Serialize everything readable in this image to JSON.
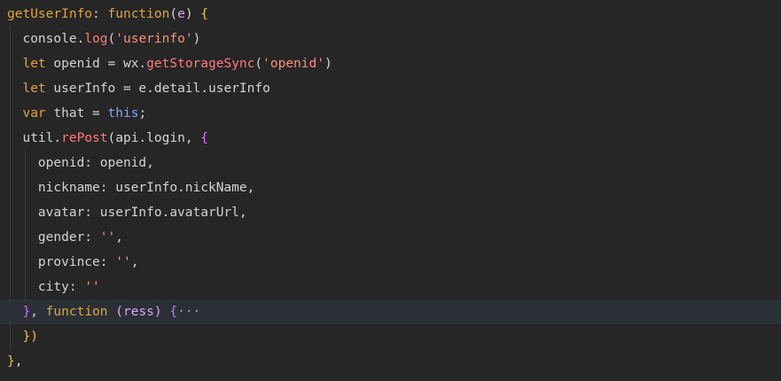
{
  "editor": {
    "background": "#262626",
    "highlight_line_background": "#2b3036",
    "lines": [
      {
        "tokens": [
          {
            "t": "getUserInfo",
            "c": "prop"
          },
          {
            "t": ": ",
            "c": "default"
          },
          {
            "t": "function",
            "c": "kw"
          },
          {
            "t": "(",
            "c": "default"
          },
          {
            "t": "e",
            "c": "param"
          },
          {
            "t": ") ",
            "c": "default"
          },
          {
            "t": "{",
            "c": "brace1"
          }
        ]
      },
      {
        "tokens": [
          {
            "t": "  ",
            "c": "default"
          },
          {
            "t": "console",
            "c": "default"
          },
          {
            "t": ".",
            "c": "default"
          },
          {
            "t": "log",
            "c": "method"
          },
          {
            "t": "(",
            "c": "default"
          },
          {
            "t": "'userinfo'",
            "c": "str"
          },
          {
            "t": ")",
            "c": "default"
          }
        ]
      },
      {
        "tokens": [
          {
            "t": "  ",
            "c": "default"
          },
          {
            "t": "let",
            "c": "let"
          },
          {
            "t": " openid = wx.",
            "c": "default"
          },
          {
            "t": "getStorageSync",
            "c": "method"
          },
          {
            "t": "(",
            "c": "default"
          },
          {
            "t": "'openid'",
            "c": "str"
          },
          {
            "t": ")",
            "c": "default"
          }
        ]
      },
      {
        "tokens": [
          {
            "t": "  ",
            "c": "default"
          },
          {
            "t": "let",
            "c": "let"
          },
          {
            "t": " userInfo = e.detail.userInfo",
            "c": "default"
          }
        ]
      },
      {
        "tokens": [
          {
            "t": "  ",
            "c": "default"
          },
          {
            "t": "var",
            "c": "var"
          },
          {
            "t": " that = ",
            "c": "default"
          },
          {
            "t": "this",
            "c": "thiskw"
          },
          {
            "t": ";",
            "c": "default"
          }
        ]
      },
      {
        "tokens": [
          {
            "t": "  ",
            "c": "default"
          },
          {
            "t": "util.",
            "c": "default"
          },
          {
            "t": "rePost",
            "c": "method"
          },
          {
            "t": "(api.login, ",
            "c": "default"
          },
          {
            "t": "{",
            "c": "brace2"
          }
        ]
      },
      {
        "tokens": [
          {
            "t": "    ",
            "c": "default"
          },
          {
            "t": "openid: openid,",
            "c": "default"
          }
        ]
      },
      {
        "tokens": [
          {
            "t": "    ",
            "c": "default"
          },
          {
            "t": "nickname: userInfo.nickName,",
            "c": "default"
          }
        ]
      },
      {
        "tokens": [
          {
            "t": "    ",
            "c": "default"
          },
          {
            "t": "avatar: userInfo.avatarUrl,",
            "c": "default"
          }
        ]
      },
      {
        "tokens": [
          {
            "t": "    ",
            "c": "default"
          },
          {
            "t": "gender: ",
            "c": "default"
          },
          {
            "t": "''",
            "c": "str"
          },
          {
            "t": ",",
            "c": "default"
          }
        ]
      },
      {
        "tokens": [
          {
            "t": "    ",
            "c": "default"
          },
          {
            "t": "province: ",
            "c": "default"
          },
          {
            "t": "''",
            "c": "str"
          },
          {
            "t": ",",
            "c": "default"
          }
        ]
      },
      {
        "tokens": [
          {
            "t": "    ",
            "c": "default"
          },
          {
            "t": "city: ",
            "c": "default"
          },
          {
            "t": "''",
            "c": "str"
          }
        ]
      },
      {
        "highlight": true,
        "tokens": [
          {
            "t": "  ",
            "c": "default"
          },
          {
            "t": "}",
            "c": "brace2"
          },
          {
            "t": ", ",
            "c": "default"
          },
          {
            "t": "function",
            "c": "kw"
          },
          {
            "t": " ",
            "c": "default"
          },
          {
            "t": "(ress)",
            "c": "param"
          },
          {
            "t": " ",
            "c": "default"
          },
          {
            "t": "{",
            "c": "brace2"
          },
          {
            "t": "···",
            "c": "ell"
          }
        ]
      },
      {
        "tokens": [
          {
            "t": "  ",
            "c": "default"
          },
          {
            "t": "})",
            "c": "brace1"
          }
        ]
      },
      {
        "tokens": [
          {
            "t": "}",
            "c": "brace1"
          },
          {
            "t": ",",
            "c": "default"
          }
        ]
      }
    ]
  }
}
